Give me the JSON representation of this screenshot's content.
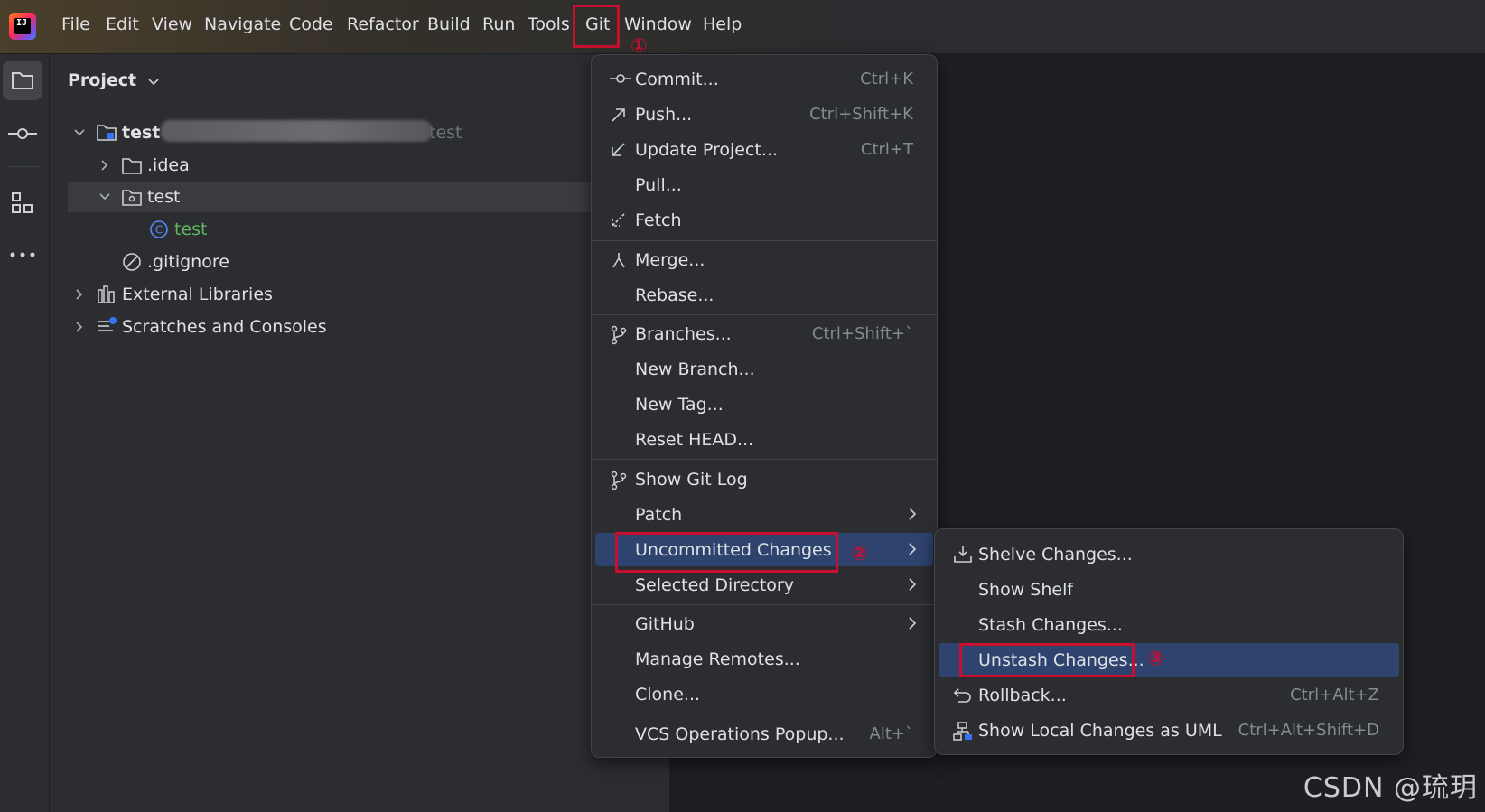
{
  "menubar": {
    "logo_text": "IJ",
    "items": [
      "File",
      "Edit",
      "View",
      "Navigate",
      "Code",
      "Refactor",
      "Build",
      "Run",
      "Tools",
      "Git",
      "Window",
      "Help"
    ]
  },
  "project": {
    "title": "Project",
    "tree": [
      {
        "label": "test",
        "suffix": "test"
      },
      {
        "label": ".idea"
      },
      {
        "label": "test"
      },
      {
        "label": "test"
      },
      {
        "label": ".gitignore"
      },
      {
        "label": "External Libraries"
      },
      {
        "label": "Scratches and Consoles"
      }
    ]
  },
  "git_menu": {
    "items": [
      {
        "label": "Commit...",
        "shortcut": "Ctrl+K",
        "icon": "commit-icon"
      },
      {
        "label": "Push...",
        "shortcut": "Ctrl+Shift+K",
        "icon": "push-arrow-icon"
      },
      {
        "label": "Update Project...",
        "shortcut": "Ctrl+T",
        "icon": "update-arrow-icon"
      },
      {
        "label": "Pull...",
        "shortcut": ""
      },
      {
        "label": "Fetch",
        "shortcut": "",
        "icon": "fetch-icon"
      },
      {
        "label": "Merge...",
        "shortcut": "",
        "icon": "merge-icon"
      },
      {
        "label": "Rebase...",
        "shortcut": ""
      },
      {
        "label": "Branches...",
        "shortcut": "Ctrl+Shift+`",
        "icon": "branch-icon"
      },
      {
        "label": "New Branch...",
        "shortcut": ""
      },
      {
        "label": "New Tag...",
        "shortcut": ""
      },
      {
        "label": "Reset HEAD...",
        "shortcut": ""
      },
      {
        "label": "Show Git Log",
        "shortcut": "",
        "icon": "git-log-icon"
      },
      {
        "label": "Patch",
        "submenu": true
      },
      {
        "label": "Uncommitted Changes",
        "submenu": true
      },
      {
        "label": "Selected Directory",
        "submenu": true
      },
      {
        "label": "GitHub",
        "submenu": true
      },
      {
        "label": "Manage Remotes...",
        "shortcut": ""
      },
      {
        "label": "Clone...",
        "shortcut": ""
      },
      {
        "label": "VCS Operations Popup...",
        "shortcut": "Alt+`"
      }
    ]
  },
  "sub_menu": {
    "items": [
      {
        "label": "Shelve Changes...",
        "shortcut": "",
        "icon": "shelve-icon"
      },
      {
        "label": "Show Shelf",
        "shortcut": ""
      },
      {
        "label": "Stash Changes...",
        "shortcut": ""
      },
      {
        "label": "Unstash Changes...",
        "shortcut": ""
      },
      {
        "label": "Rollback...",
        "shortcut": "Ctrl+Alt+Z",
        "icon": "rollback-icon"
      },
      {
        "label": "Show Local Changes as UML",
        "shortcut": "Ctrl+Alt+Shift+D",
        "icon": "uml-icon"
      }
    ]
  },
  "annotations": {
    "step1": "①",
    "step2": "②",
    "step3": "③"
  },
  "watermark": "CSDN @琉玥",
  "colors": {
    "highlight": "#2e436e",
    "annotation_red": "#c8102e",
    "accent_green": "#5fb85f"
  }
}
